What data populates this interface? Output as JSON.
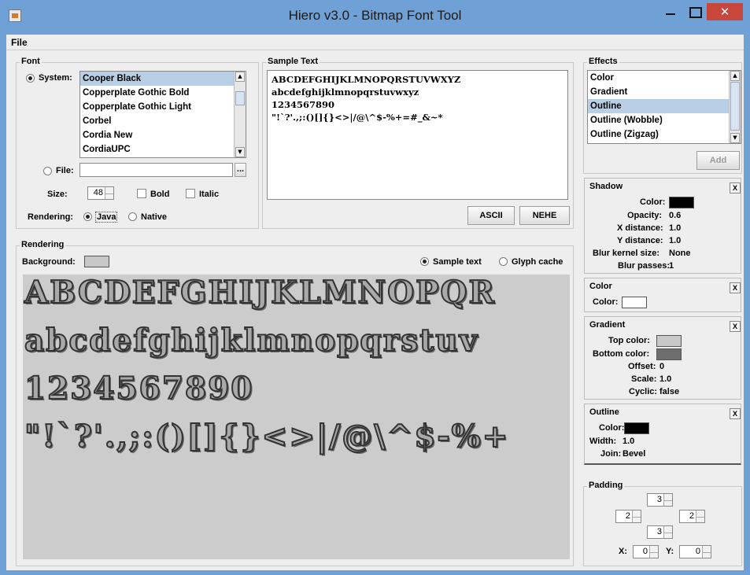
{
  "window": {
    "title": "Hiero v3.0 - Bitmap Font Tool",
    "close_glyph": "✕"
  },
  "menu": {
    "file": "File"
  },
  "font": {
    "group_title": "Font",
    "system_label": "System:",
    "fonts": [
      "Cooper Black",
      "Copperplate Gothic Bold",
      "Copperplate Gothic Light",
      "Corbel",
      "Cordia New",
      "CordiaUPC"
    ],
    "selected_index": 0,
    "file_label": "File:",
    "file_value": "",
    "browse_label": "...",
    "size_label": "Size:",
    "size_value": "48",
    "bold_label": "Bold",
    "italic_label": "Italic",
    "rendering_label": "Rendering:",
    "java_label": "Java",
    "native_label": "Native"
  },
  "sample_text": {
    "group_title": "Sample Text",
    "lines": [
      "ABCDEFGHIJKLMNOPQRSTUVWXYZ",
      "abcdefghijklmnopqrstuvwxyz",
      "1234567890",
      "\"!`?'.,;:()[]{}<>|/@\\^$-%+=#_&~*"
    ],
    "ascii_label": "ASCII",
    "nehe_label": "NEHE"
  },
  "rendering": {
    "group_title": "Rendering",
    "background_label": "Background:",
    "sample_text_label": "Sample text",
    "glyph_cache_label": "Glyph cache",
    "preview_lines": [
      "ABCDEFGHIJKLMNOPQR",
      "abcdefghijklmnopqrstuv",
      "1234567890",
      "\"!`?'.,;:()[]{}<>|/@\\^$-%+"
    ]
  },
  "effects": {
    "group_title": "Effects",
    "list": [
      "Color",
      "Gradient",
      "Outline",
      "Outline (Wobble)",
      "Outline (Zigzag)"
    ],
    "selected_index": 2,
    "add_label": "Add",
    "remove_glyph": "X",
    "shadow": {
      "title": "Shadow",
      "color_label": "Color:",
      "color": "#000000",
      "opacity_label": "Opacity:",
      "opacity": "0.6",
      "xdist_label": "X distance:",
      "xdist": "1.0",
      "ydist_label": "Y distance:",
      "ydist": "1.0",
      "blur_kernel_label": "Blur kernel size:",
      "blur_kernel": "None",
      "blur_passes_label": "Blur passes:",
      "blur_passes": "1"
    },
    "color": {
      "title": "Color",
      "color_label": "Color:",
      "color": "#ffffff"
    },
    "gradient": {
      "title": "Gradient",
      "top_label": "Top color:",
      "top_color": "#c8c8c8",
      "bottom_label": "Bottom color:",
      "bottom_color": "#6e6e6e",
      "offset_label": "Offset:",
      "offset": "0",
      "scale_label": "Scale:",
      "scale": "1.0",
      "cyclic_label": "Cyclic:",
      "cyclic": "false"
    },
    "outline": {
      "title": "Outline",
      "color_label": "Color:",
      "color": "#000000",
      "width_label": "Width:",
      "width": "1.0",
      "join_label": "Join:",
      "join": "Bevel"
    }
  },
  "padding": {
    "group_title": "Padding",
    "top": "3",
    "left": "2",
    "right": "2",
    "bottom": "3",
    "x_label": "X:",
    "x": "0",
    "y_label": "Y:",
    "y": "0"
  },
  "colors": {
    "titlebar": "#6fa0d6",
    "close_button": "#c9463d",
    "selection": "#b8cfe5"
  }
}
